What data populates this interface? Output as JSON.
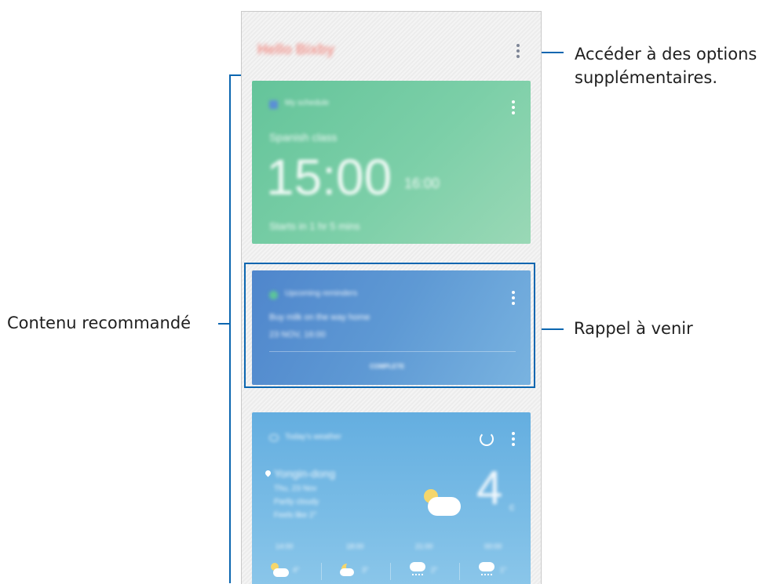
{
  "annotations": {
    "more_options_line1": "Accéder à des options",
    "more_options_line2": "supplémentaires.",
    "recommended": "Contenu recommandé",
    "reminder": "Rappel à venir"
  },
  "header": {
    "brand": "Hello Bixby"
  },
  "event_card": {
    "source": "My schedule",
    "title": "Spanish class",
    "start_time": "15:00",
    "end_time": "16:00",
    "footer": "Starts in 1 hr 5 mins"
  },
  "reminder_card": {
    "source": "Upcoming reminders",
    "text": "Buy milk on the way home",
    "datetime": "23 NOV, 16:00",
    "action": "COMPLETE"
  },
  "weather_card": {
    "source": "Today's weather",
    "location": "Yongin-dong",
    "detail_1": "Thu, 23 Nov",
    "detail_2": "Partly cloudy",
    "detail_3": "Feels like 2°",
    "temperature": "4",
    "unit": "c",
    "forecast": [
      {
        "time": "14:00",
        "temp": "4°",
        "icon": "partly-cloudy-icon"
      },
      {
        "time": "18:00",
        "temp": "3°",
        "icon": "moon-icon"
      },
      {
        "time": "21:00",
        "temp": "2°",
        "icon": "rain-icon"
      },
      {
        "time": "00:00",
        "temp": "1°",
        "icon": "rain-icon"
      }
    ]
  },
  "colors": {
    "annotation_line": "#0b66b0",
    "event_card": "#74cba3",
    "reminder_card": "#5b93d2",
    "weather_card": "#75b8e4"
  }
}
